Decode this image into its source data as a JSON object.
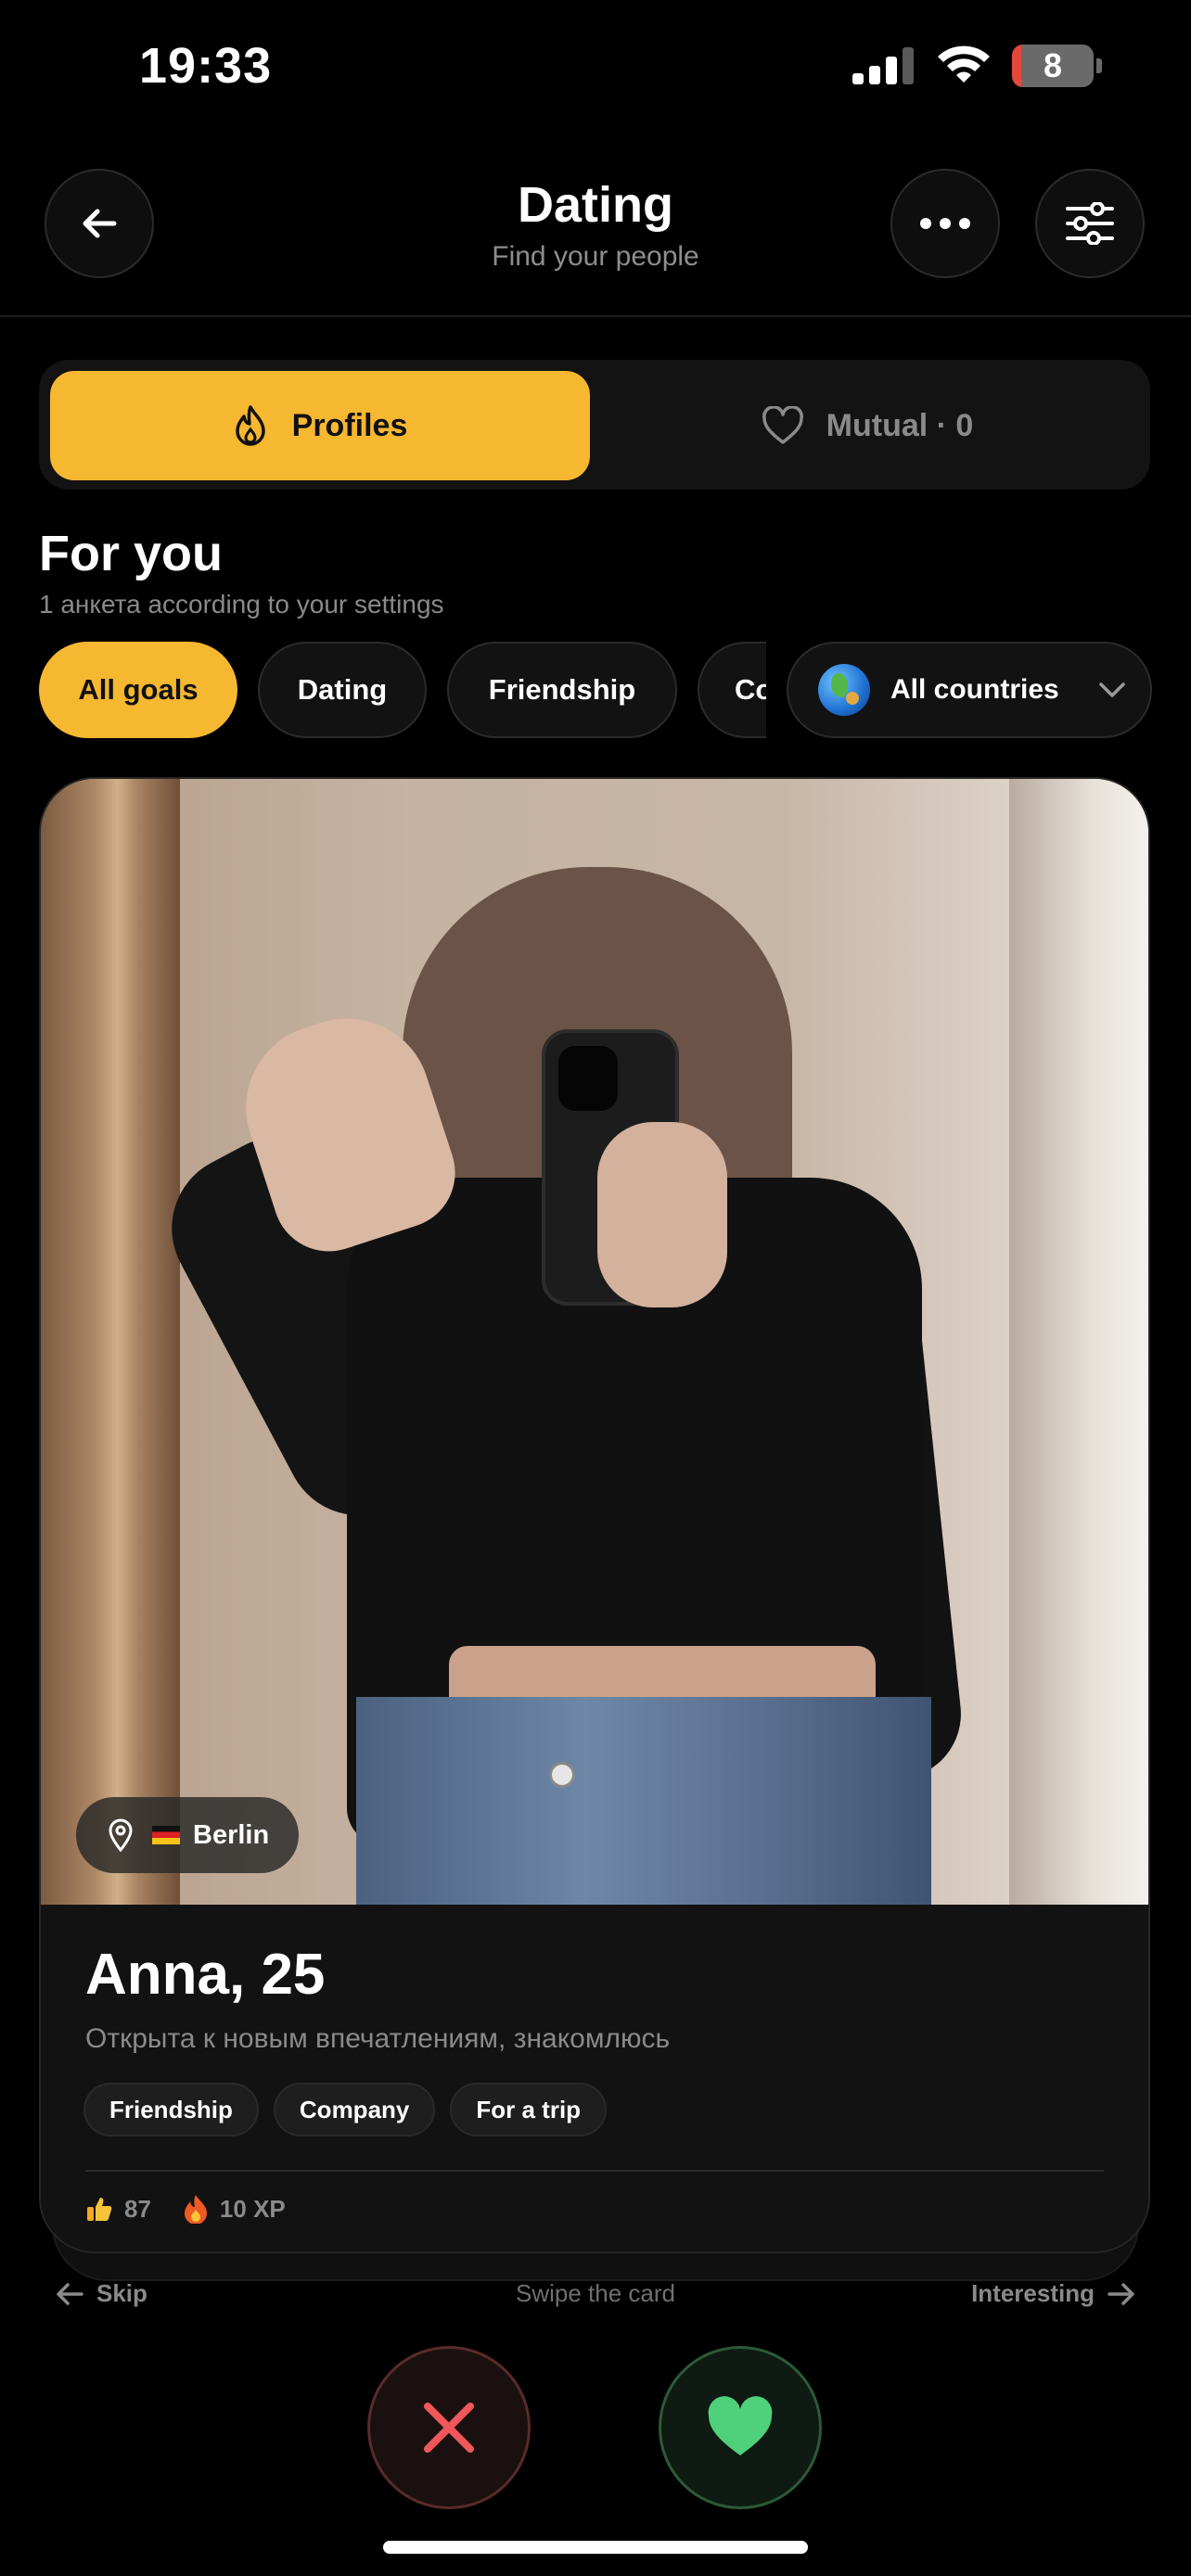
{
  "status": {
    "time": "19:33",
    "battery": "8"
  },
  "header": {
    "title": "Dating",
    "subtitle": "Find your people"
  },
  "segments": {
    "profiles": "Profiles",
    "mutual": "Mutual · 0"
  },
  "feed": {
    "title": "For you",
    "subtitle": "1 анкета according to your settings"
  },
  "filters": {
    "goals": [
      "All goals",
      "Dating",
      "Friendship",
      "Co"
    ],
    "country": "All countries"
  },
  "profile": {
    "location": "Berlin",
    "name": "Anna, 25",
    "bio": "Открыта к новым впечатлениям, знакомлюсь",
    "tags": [
      "Friendship",
      "Company",
      "For a trip"
    ],
    "likes": "87",
    "xp": "10 XP"
  },
  "hints": {
    "skip": "Skip",
    "center": "Swipe the card",
    "interesting": "Interesting"
  },
  "colors": {
    "accent": "#f6b731",
    "skip": "#f0575a",
    "like": "#4fd07a",
    "background": "#000000"
  }
}
